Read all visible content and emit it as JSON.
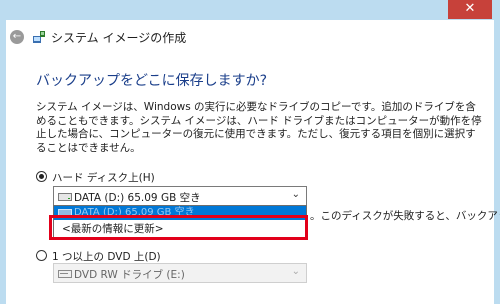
{
  "window": {
    "close_glyph": "✕"
  },
  "nav": {
    "title": "システム イメージの作成",
    "back_glyph": "←"
  },
  "heading": "バックアップをどこに保存しますか?",
  "description": "システム イメージは、Windows の実行に必要なドライブのコピーです。追加のドライブを含めることもできます。システム イメージは、ハード ドライブまたはコンピューターが動作を停止した場合に、コンピューターの復元に使用できます。ただし、復元する項目を個別に選択することはできません。",
  "hard_disk": {
    "label": "ハード ディスク上(H)",
    "checked": true,
    "selected_value": "DATA (D:)  65.09 GB 空き",
    "options": [
      {
        "label": "DATA (D:)  65.09 GB 空き"
      },
      {
        "label": "<最新の情報に更新>"
      }
    ],
    "warning_partial": "。このディスクが失敗すると、バックアッ"
  },
  "dvd": {
    "label": "1 つ以上の DVD 上(D)",
    "checked": false,
    "selected_value": "DVD RW ドライブ (E:)"
  },
  "icons": {
    "back": "back-arrow-icon",
    "app": "system-image-icon",
    "drive": "hard-drive-icon",
    "dvd": "dvd-drive-icon",
    "dropdown": "chevron-down-icon"
  },
  "colors": {
    "title_bar": "#bcdcf0",
    "close_button": "#c7413a",
    "heading": "#1a3e8a",
    "selection": "#0078d7",
    "annotation": "#e2001a"
  }
}
